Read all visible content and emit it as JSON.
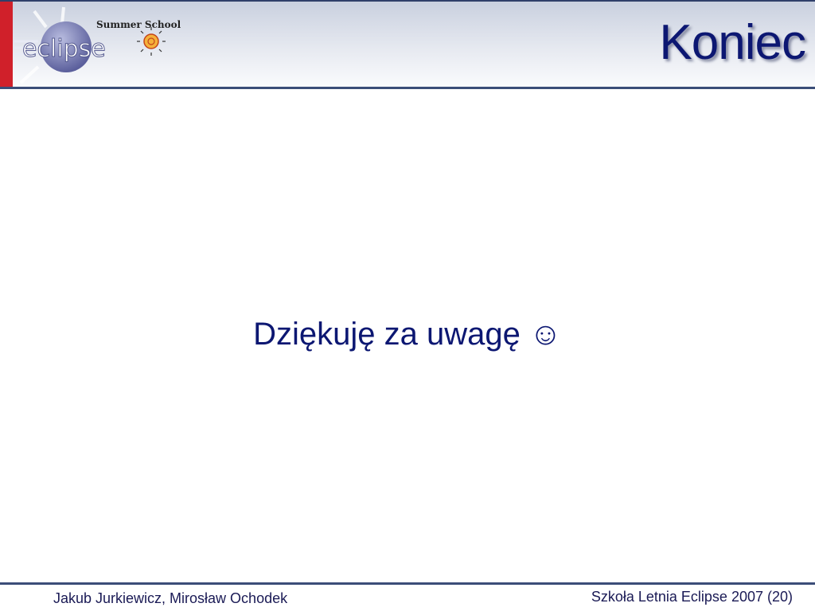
{
  "header": {
    "logo_text": "eclipse",
    "logo_subtitle": "Summer School",
    "title": "Koniec"
  },
  "main": {
    "text": "Dziękuję za uwagę ☺"
  },
  "footer": {
    "authors": "Jakub Jurkiewicz, Mirosław Ochodek",
    "event_page": "Szkoła Letnia Eclipse 2007 (20)"
  }
}
